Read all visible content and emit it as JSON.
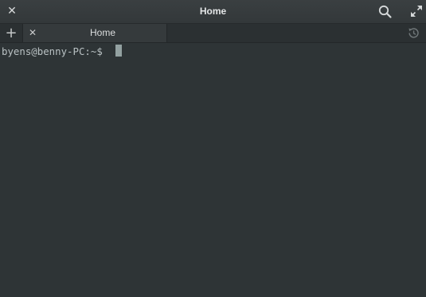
{
  "window": {
    "title": "Home",
    "close_icon": "close-icon",
    "search_icon": "search-icon",
    "maximize_icon": "maximize-icon"
  },
  "tabs": {
    "new_tab_icon": "plus-icon",
    "history_icon": "history-icon",
    "items": [
      {
        "label": "Home",
        "close_icon": "close-icon",
        "active": true
      }
    ]
  },
  "terminal": {
    "prompt": "byens@benny-PC:~$ ",
    "input": "",
    "colors": {
      "background": "#2e3436",
      "foreground": "#b9c1c3",
      "cursor": "#93a1a1"
    }
  }
}
